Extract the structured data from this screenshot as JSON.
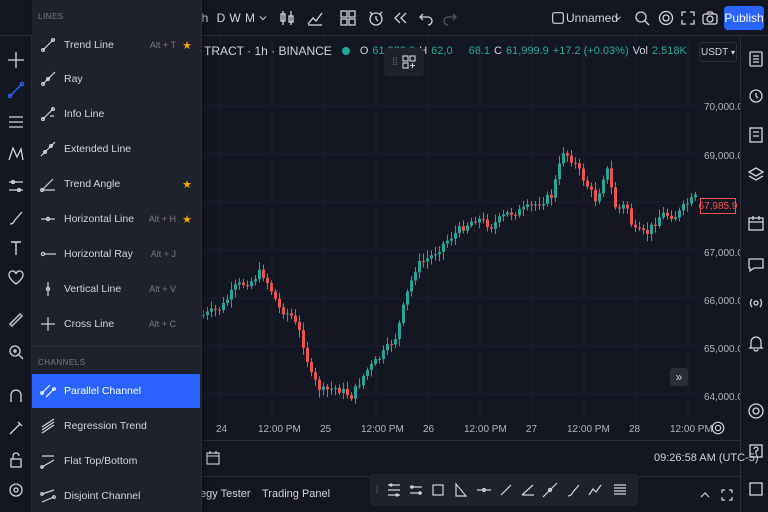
{
  "toolbar": {
    "interval": "h",
    "intervals": [
      "D",
      "W",
      "M"
    ],
    "layout_name": "Unnamed",
    "publish_label": "Publish"
  },
  "legend": {
    "symbol": "TRACT · 1h · BINANCE",
    "open_label": "O",
    "open": "61,982.8",
    "high_label": "H",
    "high": "62,0",
    "low_tail": "68.1",
    "close_label": "C",
    "close": "61,999.9",
    "change": "+17.2 (+0.03%)",
    "vol_label": "Vol",
    "vol": "2.518K"
  },
  "currency": "USDT",
  "price_tag": "67,985.9",
  "y_axis": [
    "70,000.0",
    "69,000.0",
    "68,000.0",
    "67,000.0",
    "66,000.0",
    "65,000.0",
    "64,000.0"
  ],
  "x_axis": [
    "24",
    "12:00 PM",
    "25",
    "12:00 PM",
    "26",
    "12:00 PM",
    "27",
    "12:00 PM",
    "28",
    "12:00 PM"
  ],
  "clock": "09:26:58 AM (UTC-5)",
  "bottom_tabs": [
    "egy Tester",
    "Trading Panel"
  ],
  "menu": {
    "sections": [
      {
        "title": "LINES",
        "items": [
          {
            "label": "Trend Line",
            "hotkey": "Alt + T",
            "starred": true,
            "icon": "trend-line-icon"
          },
          {
            "label": "Ray",
            "hotkey": "",
            "starred": false,
            "icon": "ray-icon"
          },
          {
            "label": "Info Line",
            "hotkey": "",
            "starred": false,
            "icon": "info-line-icon"
          },
          {
            "label": "Extended Line",
            "hotkey": "",
            "starred": false,
            "icon": "extended-line-icon"
          },
          {
            "label": "Trend Angle",
            "hotkey": "",
            "starred": true,
            "icon": "trend-angle-icon"
          },
          {
            "label": "Horizontal Line",
            "hotkey": "Alt + H",
            "starred": true,
            "icon": "horizontal-line-icon"
          },
          {
            "label": "Horizontal Ray",
            "hotkey": "Alt + J",
            "starred": false,
            "icon": "horizontal-ray-icon"
          },
          {
            "label": "Vertical Line",
            "hotkey": "Alt + V",
            "starred": false,
            "icon": "vertical-line-icon"
          },
          {
            "label": "Cross Line",
            "hotkey": "Alt + C",
            "starred": false,
            "icon": "cross-line-icon"
          }
        ]
      },
      {
        "title": "CHANNELS",
        "items": [
          {
            "label": "Parallel Channel",
            "hotkey": "",
            "starred": false,
            "active": true,
            "icon": "parallel-channel-icon"
          },
          {
            "label": "Regression Trend",
            "hotkey": "",
            "starred": false,
            "icon": "regression-trend-icon"
          },
          {
            "label": "Flat Top/Bottom",
            "hotkey": "",
            "starred": false,
            "icon": "flat-top-bottom-icon"
          },
          {
            "label": "Disjoint Channel",
            "hotkey": "",
            "starred": false,
            "icon": "disjoint-channel-icon"
          }
        ]
      }
    ]
  },
  "colors": {
    "up": "#26a69a",
    "down": "#ef5350",
    "accent": "#2962ff",
    "star": "#f7a600"
  },
  "star_glyph": "★",
  "scroll_glyph": "»"
}
